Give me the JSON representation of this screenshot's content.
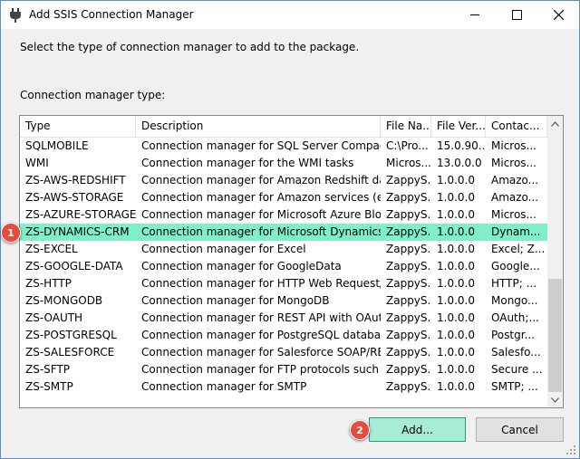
{
  "window": {
    "title": "Add SSIS Connection Manager"
  },
  "instruction": "Select the type of connection manager to add to the package.",
  "list_label": "Connection manager type:",
  "columns": [
    "Type",
    "Description",
    "File Na...",
    "File Ver...",
    "Contac..."
  ],
  "rows": [
    [
      "SQLMOBILE",
      "Connection manager for SQL Server Compact ...",
      "C:\\Pro...",
      "15.0.90...",
      "Micros..."
    ],
    [
      "WMI",
      "Connection manager for the WMI tasks",
      "Micros...",
      "13.0.0.0",
      "Micros..."
    ],
    [
      "ZS-AWS-REDSHIFT",
      "Connection manager for Amazon Redshift data...",
      "ZappyS...",
      "1.0.0.0",
      "Amazo..."
    ],
    [
      "ZS-AWS-STORAGE",
      "Connection manager for Amazon services (e.g....",
      "ZappyS...",
      "1.0.0.0",
      "Amazo..."
    ],
    [
      "ZS-AZURE-STORAGE",
      "Connection manager for Microsoft Azure Blob ...",
      "ZappyS...",
      "1.0.0.0",
      "Micros..."
    ],
    [
      "ZS-DYNAMICS-CRM",
      "Connection manager for Microsoft Dynamics ...",
      "ZappyS...",
      "1.0.0.0",
      "Dynam..."
    ],
    [
      "ZS-EXCEL",
      "Connection manager for Excel",
      "ZappyS...",
      "1.0.0.0",
      "Excel; Z..."
    ],
    [
      "ZS-GOOGLE-DATA",
      "Connection manager for GoogleData",
      "ZappyS...",
      "1.0.0.0",
      "Google..."
    ],
    [
      "ZS-HTTP",
      "Connection manager for HTTP Web Request/R...",
      "ZappyS...",
      "1.0.0.0",
      "HTTP; ..."
    ],
    [
      "ZS-MONGODB",
      "Connection manager for MongoDB",
      "ZappyS...",
      "1.0.0.0",
      "Mongo..."
    ],
    [
      "ZS-OAUTH",
      "Connection manager for REST API with OAuth ...",
      "ZappyS...",
      "1.0.0.0",
      "OAuth;..."
    ],
    [
      "ZS-POSTGRESQL",
      "Connection manager for PostgreSQL database",
      "ZappyS...",
      "1.0.0.0",
      "Postgr..."
    ],
    [
      "ZS-SALESFORCE",
      "Connection manager for Salesforce SOAP/RES...",
      "ZappyS...",
      "1.0.0.0",
      "Salesfo..."
    ],
    [
      "ZS-SFTP",
      "Connection manager for FTP protocols such as...",
      "ZappyS...",
      "1.0.0.0",
      "Secure ..."
    ],
    [
      "ZS-SMTP",
      "Connection manager for SMTP",
      "ZappyS...",
      "1.0.0.0",
      "SMTP; ..."
    ]
  ],
  "selected_row": 5,
  "buttons": {
    "add": "Add...",
    "cancel": "Cancel"
  },
  "badges": {
    "first": "1",
    "second": "2"
  },
  "colors": {
    "selected_row": "#7fefc9",
    "add_button": "#a6ecd6",
    "badge": "#e84a3d"
  },
  "icons": {
    "title": "plug-icon"
  }
}
